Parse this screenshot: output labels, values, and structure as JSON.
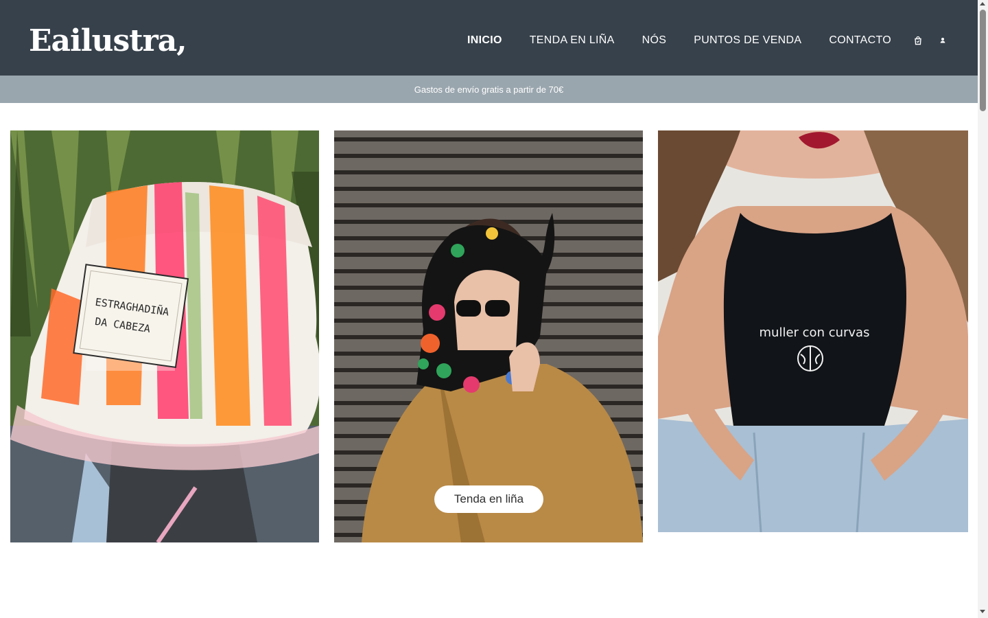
{
  "brand": {
    "logo_text": "Eailustra,"
  },
  "nav": {
    "items": [
      {
        "label": "INICIO",
        "active": true
      },
      {
        "label": "TENDA EN LIÑA",
        "active": false
      },
      {
        "label": "NÓS",
        "active": false
      },
      {
        "label": "PUNTOS DE VENDA",
        "active": false
      },
      {
        "label": "CONTACTO",
        "active": false
      }
    ],
    "icons": [
      "shopping-bag-icon",
      "user-icon"
    ]
  },
  "promo": {
    "text": "Gastos de envío gratis a partir de 70€"
  },
  "gallery": {
    "cards": [
      {
        "image": "bucket-hat-photo",
        "patch_line1": "ESTRAGHADIÑA",
        "patch_line2": "DA CABEZA"
      },
      {
        "image": "headscarf-photo",
        "button_label": "Tenda en liña"
      },
      {
        "image": "crop-top-photo",
        "shirt_text": "muller con curvas"
      }
    ]
  },
  "colors": {
    "header_bg": "#37414b",
    "promo_bg": "#9aa6ae",
    "page_bg": "#ffffff"
  }
}
